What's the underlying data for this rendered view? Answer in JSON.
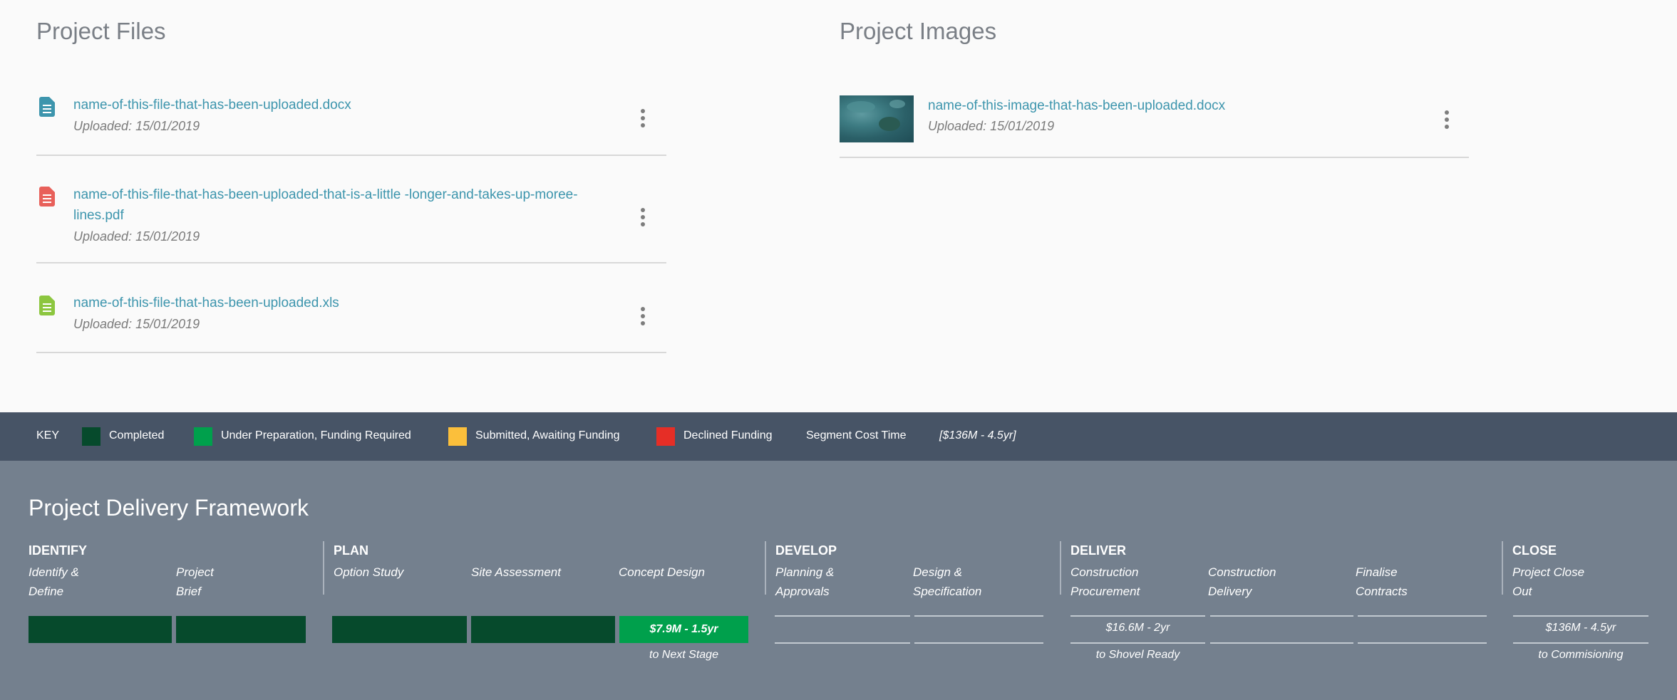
{
  "files": {
    "title": "Project Files",
    "items": [
      {
        "name": "name-of-this-file-that-has-been-uploaded.docx",
        "uploaded": "Uploaded: 15/01/2019",
        "icon": "doc-file-icon",
        "color": "#3d95ad"
      },
      {
        "name_line1": "name-of-this-file-that-has-been-uploaded-that-is-a-little -longer-and-takes-up-moree-",
        "name_line2": "lines.pdf",
        "uploaded": "Uploaded: 15/01/2019",
        "icon": "pdf-file-icon",
        "color": "#e8605a"
      },
      {
        "name": "name-of-this-file-that-has-been-uploaded.xls",
        "uploaded": "Uploaded: 15/01/2019",
        "icon": "xls-file-icon",
        "color": "#8cc63f"
      }
    ]
  },
  "images": {
    "title": "Project Images",
    "items": [
      {
        "name": "name-of-this-image-that-has-been-uploaded.docx",
        "uploaded": "Uploaded: 15/01/2019",
        "icon": "image-thumbnail"
      }
    ]
  },
  "key": {
    "label": "KEY",
    "items": [
      {
        "label": "Completed",
        "color": "#064a2c"
      },
      {
        "label": "Under Preparation, Funding Required",
        "color": "#00a04c"
      },
      {
        "label": "Submitted, Awaiting Funding",
        "color": "#fbbf3b"
      },
      {
        "label": "Declined Funding",
        "color": "#e62e26"
      }
    ],
    "segment_label": "Segment Cost Time",
    "segment_example": "[$136M - 4.5yr]"
  },
  "framework": {
    "title": "Project Delivery Framework",
    "phases": {
      "identify": {
        "label": "IDENTIFY",
        "steps": [
          {
            "line1": "Identify &",
            "line2": "Define",
            "status": "completed"
          },
          {
            "line1": "Project",
            "line2": "Brief",
            "status": "completed"
          }
        ]
      },
      "plan": {
        "label": "PLAN",
        "steps": [
          {
            "line1": "Option Study",
            "line2": "",
            "status": "completed"
          },
          {
            "line1": "Site Assessment",
            "line2": "",
            "status": "completed"
          },
          {
            "line1": "Concept Design",
            "line2": "",
            "status": "under-preparation",
            "value": "$7.9M - 1.5yr"
          }
        ],
        "note": "to Next Stage"
      },
      "develop": {
        "label": "DEVELOP",
        "steps": [
          {
            "line1": "Planning &",
            "line2": "Approvals"
          },
          {
            "line1": "Design &",
            "line2": "Specification"
          }
        ]
      },
      "deliver": {
        "label": "DELIVER",
        "steps": [
          {
            "line1": "Construction",
            "line2": "Procurement",
            "value": "$16.6M - 2yr"
          },
          {
            "line1": "Construction",
            "line2": "Delivery"
          },
          {
            "line1": "Finalise",
            "line2": "Contracts"
          }
        ],
        "note": "to Shovel Ready"
      },
      "close": {
        "label": "CLOSE",
        "steps": [
          {
            "line1": "Project Close",
            "line2": "Out",
            "value": "$136M - 4.5yr"
          }
        ],
        "note": "to Commisioning"
      }
    }
  }
}
